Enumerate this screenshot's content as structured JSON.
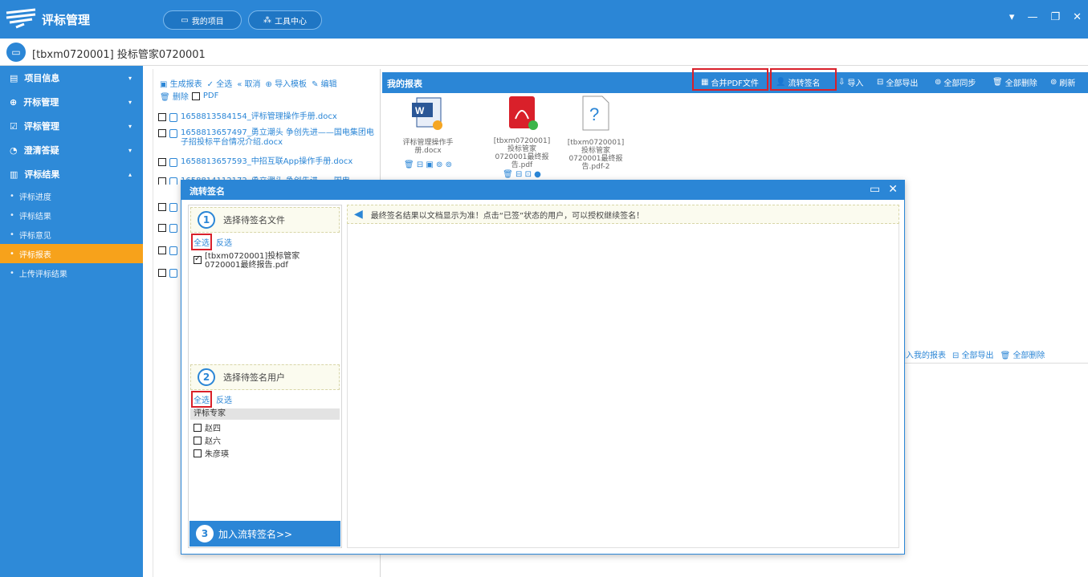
{
  "app": {
    "title": "评标管理",
    "brand_color": "#2b86d6"
  },
  "topbar": {
    "my_project": "我的项目",
    "tool_center": "工具中心",
    "controls": [
      "▾",
      "—",
      "❐",
      "✕"
    ]
  },
  "project": {
    "title": "[tbxm0720001] 投标管家0720001"
  },
  "sidebar": {
    "sections": [
      {
        "label": "项目信息",
        "icon": "project-info-icon",
        "chevron": "▾"
      },
      {
        "label": "开标管理",
        "icon": "bid-open-icon",
        "chevron": "▾"
      },
      {
        "label": "评标管理",
        "icon": "evaluation-icon",
        "chevron": "▾"
      },
      {
        "label": "澄清答疑",
        "icon": "clarify-icon",
        "chevron": "▾"
      },
      {
        "label": "评标结果",
        "icon": "result-icon",
        "chevron": "▴"
      }
    ],
    "subitems": [
      "评标进度",
      "评标结果",
      "评标意见",
      "评标报表",
      "上传评标结果"
    ],
    "active_subitem": "评标报表"
  },
  "left_toolbar": {
    "generate": "生成报表",
    "select_all": "全选",
    "cancel": "取消",
    "import_template": "导入模板",
    "edit": "编辑",
    "delete": "删除",
    "pdf": "PDF"
  },
  "left_files": [
    "1658813584154_评标管理操作手册.docx",
    "1658813657497_勇立潮头 争创先进——国电集团电子招投标平台情况介绍.docx",
    "1658813657593_中招互联App操作手册.docx",
    "1658814112172_勇立潮头 争创先进——国电"
  ],
  "reports": {
    "title": "我的报表",
    "buttons": [
      "合并PDF文件",
      "流转签名",
      "导入",
      "全部导出",
      "全部同步",
      "全部删除",
      "刷新"
    ],
    "files": [
      {
        "name": "评标管理操作手册.docx",
        "type": "word"
      },
      {
        "name": "[tbxm0720001]投标管家0720001最终报告.pdf",
        "type": "pdf"
      },
      {
        "name": "[tbxm0720001]投标管家0720001最终报告.pdf-2",
        "type": "unknown"
      }
    ]
  },
  "bottom_actions": [
    "加入我的报表",
    "全部导出",
    "全部删除"
  ],
  "modal": {
    "title": "流转签名",
    "step1": {
      "num": "1",
      "label": "选择待签名文件"
    },
    "step2": {
      "num": "2",
      "label": "选择待签名用户"
    },
    "step3": {
      "num": "3",
      "label": "加入流转签名>>"
    },
    "select_all": "全选",
    "invert": "反选",
    "files": [
      {
        "name": "[tbxm0720001]投标管家0720001最终报告.pdf",
        "checked": true
      }
    ],
    "user_group": "评标专家",
    "users": [
      {
        "name": "赵四",
        "checked": false
      },
      {
        "name": "赵六",
        "checked": false
      },
      {
        "name": "朱彦瑛",
        "checked": false
      }
    ],
    "notice": "最终签名结果以文档显示为准！点击“已签”状态的用户，可以授权继续签名！"
  }
}
